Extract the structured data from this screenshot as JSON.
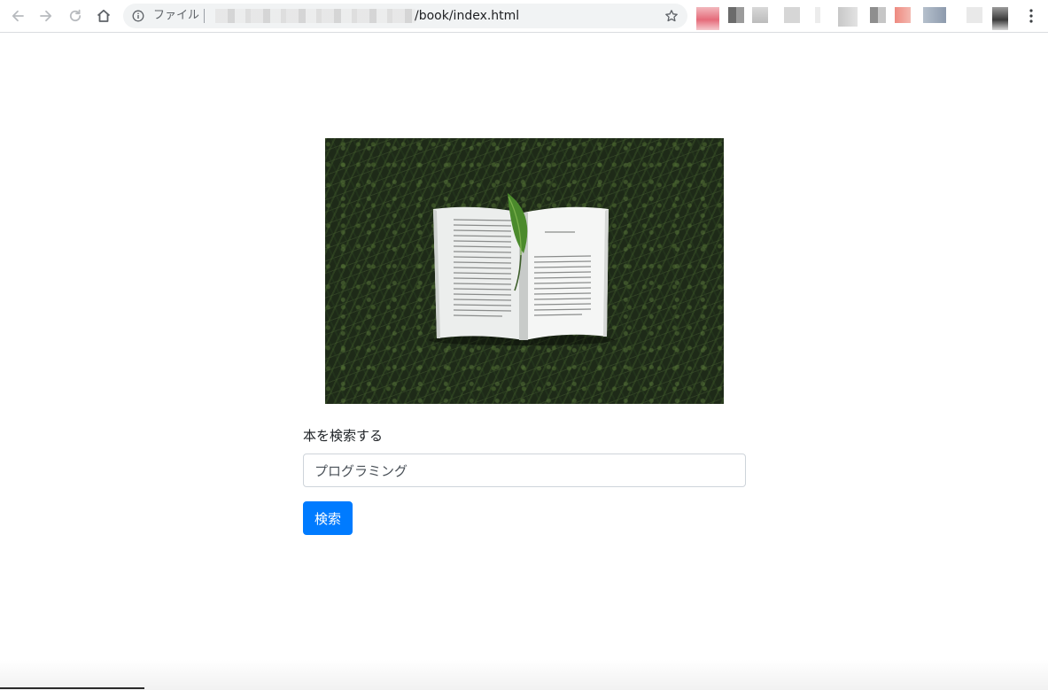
{
  "browser": {
    "scheme_label": "ファイル",
    "url_path": "/book/index.html",
    "icons": {
      "back": "arrow-left-icon",
      "forward": "arrow-right-icon",
      "reload": "reload-icon",
      "home": "home-icon",
      "info": "info-icon",
      "bookmark": "star-icon",
      "menu": "kebab-menu-icon"
    }
  },
  "page": {
    "hero_image": "open-book-on-grass-image",
    "search_label": "本を検索する",
    "search_value": "プログラミング",
    "search_button_label": "検索",
    "colors": {
      "primary": "#007bff",
      "text": "#212529",
      "input_border": "#ced4da"
    }
  }
}
